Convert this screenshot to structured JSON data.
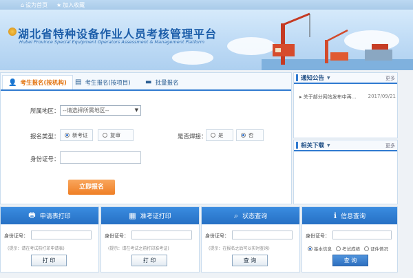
{
  "topbar": {
    "home_icon": "home-icon",
    "set_home": "设为首页",
    "fav_icon": "star-icon",
    "add_fav": "加入收藏"
  },
  "banner": {
    "title_cn": "湖北省特种设备作业人员考核管理平台",
    "title_en": "Hubei Province Special Equipment Operators Assessment & Management Platform"
  },
  "tabs": [
    {
      "label": "考生报名(按机构)",
      "icon": "user-icon",
      "active": true
    },
    {
      "label": "考生报名(按项目)",
      "icon": "document-icon",
      "active": false
    },
    {
      "label": "批量报名",
      "icon": "folder-icon",
      "active": false
    }
  ],
  "form": {
    "region_label": "所属地区：",
    "region_value": "--请选择所属地区--",
    "type_label": "报名类型：",
    "type_opt_new": "新考证",
    "type_opt_review": "复审",
    "weld_label": "是否焊接：",
    "weld_yes": "是",
    "weld_no": "否",
    "id_label": "身份证号：",
    "submit": "立即报名"
  },
  "notice": {
    "title": "通知公告",
    "more": "更多",
    "item": "关于部分网站发布中再...",
    "date": "2017/09/21"
  },
  "downloads": {
    "title": "相关下载",
    "more": "更多"
  },
  "bottom": [
    {
      "title": "申请表打印",
      "icon": "printer-icon",
      "id_label": "身份证号：",
      "hint": "(提示：请在考试前打印申请表)",
      "button": "打 印"
    },
    {
      "title": "准考证打印",
      "icon": "calendar-icon",
      "id_label": "身份证号：",
      "hint": "(提示：请在考试之前打印准考证)",
      "button": "打 印"
    },
    {
      "title": "状态查询",
      "icon": "search-icon",
      "id_label": "身份证号：",
      "hint": "(提示：在报名之后可以实时查询)",
      "button": "查 询"
    },
    {
      "title": "信息查询",
      "icon": "info-icon",
      "id_label": "身份证号：",
      "radios": [
        "基本信息",
        "考试成绩",
        "证件情况"
      ],
      "button": "查 询"
    }
  ]
}
